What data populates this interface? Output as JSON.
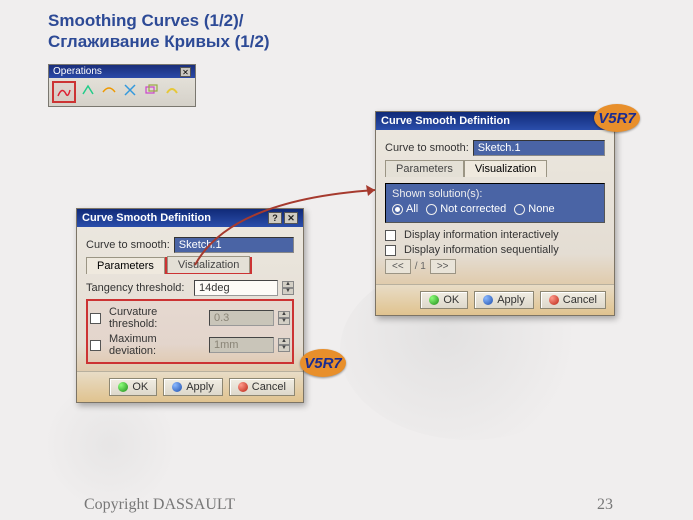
{
  "title_line1": "Smoothing Curves (1/2)/",
  "title_line2": "Сглаживание Кривых (1/2)",
  "toolbar": {
    "title": "Operations"
  },
  "dialog_a": {
    "title": "Curve Smooth Definition",
    "curve_label": "Curve to smooth:",
    "curve_value": "Sketch.1",
    "tab_params": "Parameters",
    "tab_visual": "Visualization",
    "tangency_label": "Tangency threshold:",
    "tangency_value": "14deg",
    "curvature_label": "Curvature threshold:",
    "curvature_value": "0.3",
    "maxdev_label": "Maximum deviation:",
    "maxdev_value": "1mm",
    "ok": "OK",
    "apply": "Apply",
    "cancel": "Cancel"
  },
  "dialog_b": {
    "title": "Curve Smooth Definition",
    "curve_label": "Curve to smooth:",
    "curve_value": "Sketch.1",
    "tab_params": "Parameters",
    "tab_visual": "Visualization",
    "shown_label": "Shown solution(s):",
    "opt_all": "All",
    "opt_notcorr": "Not corrected",
    "opt_none": "None",
    "disp_inter": "Display information interactively",
    "disp_seq": "Display information sequentially",
    "nav_sep": "/ 1",
    "nav_prev": "<<",
    "nav_next": ">>",
    "ok": "OK",
    "apply": "Apply",
    "cancel": "Cancel"
  },
  "badge": "V5R7",
  "footer_left": "Copyright DASSAULT",
  "footer_right": "23"
}
